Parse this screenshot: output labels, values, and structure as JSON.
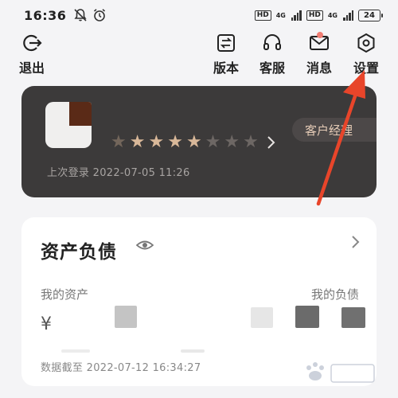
{
  "status_bar": {
    "time": "16:36",
    "network_badge": "HD",
    "network_type": "4G",
    "battery": "24"
  },
  "toolbar": {
    "logout_label": "退出",
    "version_label": "版本",
    "service_label": "客服",
    "messages_label": "消息",
    "settings_label": "设置"
  },
  "profile": {
    "rating": 5,
    "rating_max": 8,
    "manager_button": "客户经理",
    "last_login": "上次登录 2022-07-05 11:26"
  },
  "assets": {
    "title": "资产负债",
    "my_assets_label": "我的资产",
    "my_liabilities_label": "我的负债",
    "currency_symbol": "¥",
    "data_cutoff": "数据截至 2022-07-12 16:34:27"
  },
  "colors": {
    "card_dark": "#3c3a3a",
    "star_active": "#d9b899",
    "manager_text": "#e6ccb7",
    "arrow": "#e8452a",
    "message_badge": "#f07d73"
  }
}
